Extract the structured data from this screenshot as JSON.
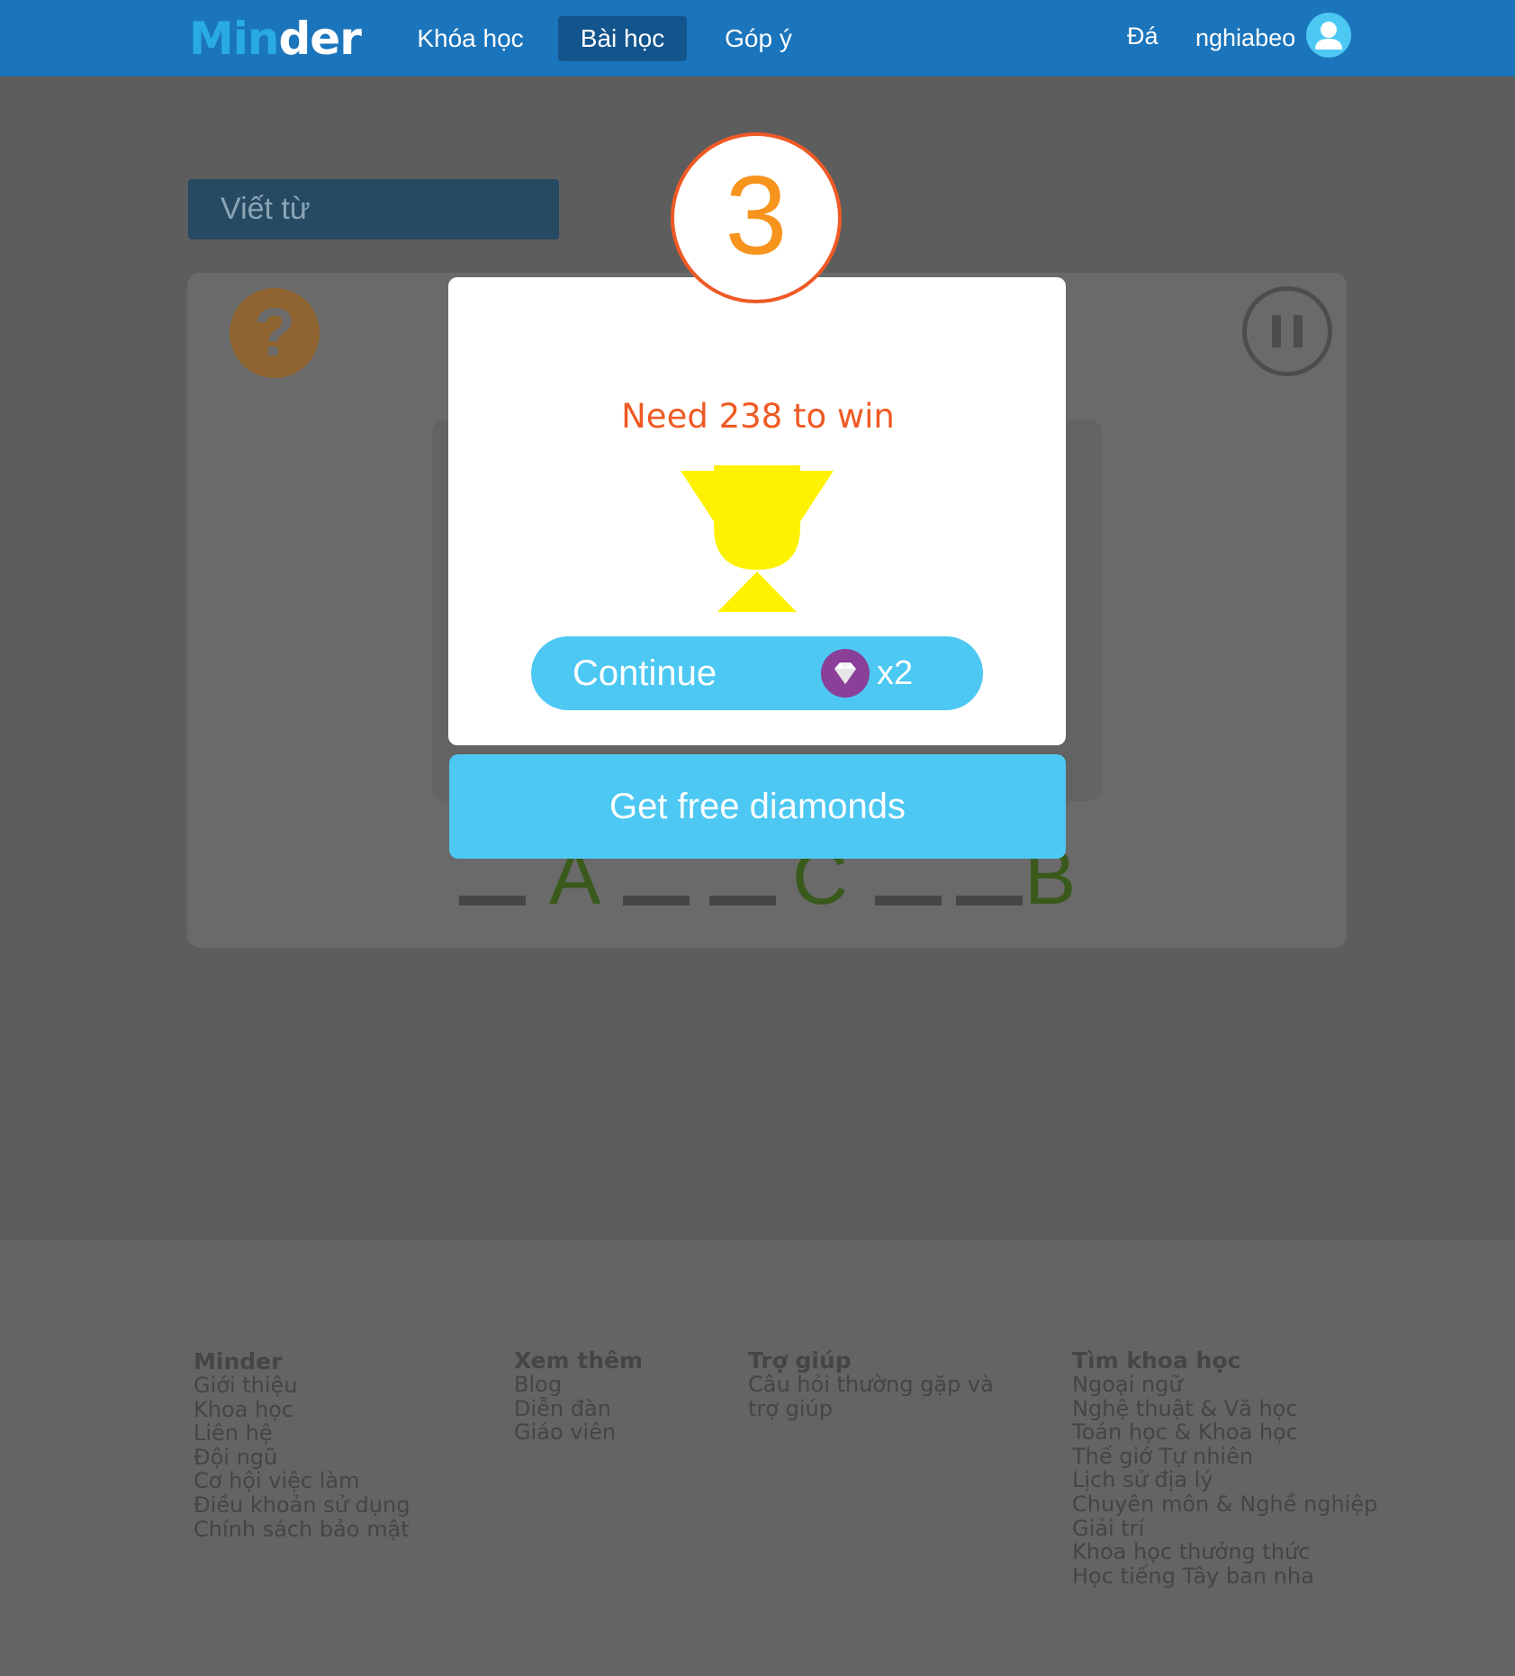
{
  "header": {
    "logo_part1": "Min",
    "logo_part2": "d",
    "logo_part3": "er",
    "nav": [
      "Khóa học",
      "Bài học",
      "Góp ý"
    ],
    "active_nav": "Bài học",
    "right_label": "Đá",
    "username": "nghiabeo",
    "avatar_icon": "user-icon",
    "brand_color": "#1b75bc"
  },
  "lesson": {
    "section_title": "Viết từ",
    "help_icon": "question-mark-icon",
    "help_glyph": "?",
    "pause_icon": "pause-icon",
    "letters": [
      "A",
      "C",
      "B"
    ]
  },
  "modal": {
    "countdown": "3",
    "goal_text": "Need 238 to win",
    "trophy_icon": "trophy-icon",
    "continue_label": "Continue",
    "diamond_icon": "diamond-icon",
    "cost_label": "x2",
    "free_diamonds_label": "Get free diamonds",
    "accent_color": "#4cc8f3",
    "highlight_color": "#ef5a24"
  },
  "footer": {
    "columns": [
      {
        "title": "Minder",
        "links": [
          "Giới thiệu",
          "Khoa học",
          "Liên hệ",
          "Đội ngũ",
          "Cơ hội việc làm",
          "Điều khoản sử dụng",
          "Chính sách bảo mật"
        ]
      },
      {
        "title": "Xem thêm",
        "links": [
          "Blog",
          "Diễn đàn",
          "Giáo viên"
        ]
      },
      {
        "title": "Trợ giúp",
        "links": [
          "Câu hỏi thường gặp và",
          "trợ giúp"
        ]
      },
      {
        "title": "Tìm khoa học",
        "links": [
          "Ngoại ngữ",
          "Nghệ thuật & Vă học",
          "Toán học & Khoa học",
          "Thế giớ Tự nhiên",
          "Lịch sử địa lý",
          "Chuyên môn & Nghề nghiệp",
          "Giải trí",
          "Khoa học thưởng thức",
          "Học tiếng Tây ban nha"
        ]
      }
    ]
  }
}
